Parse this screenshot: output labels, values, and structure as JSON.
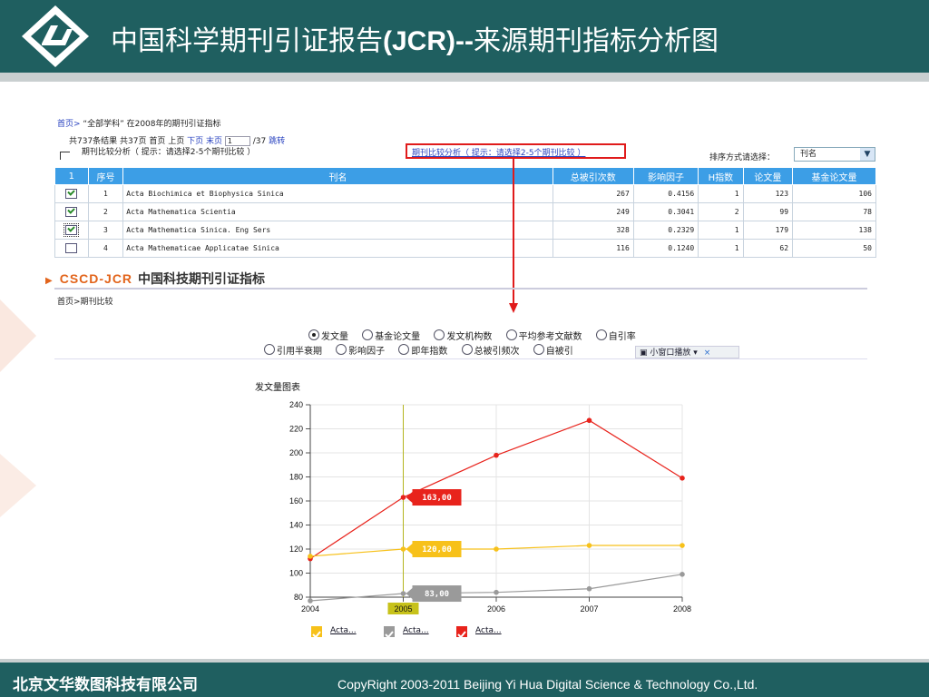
{
  "header": {
    "title_prefix": "中国科学期刊引证报告",
    "title_bold": "(JCR)--",
    "title_suffix": "来源期刊指标分析图"
  },
  "search_area": {
    "breadcrumb_home": "首页>",
    "breadcrumb_text": "“全部学科” 在2008年的期刊引证指标",
    "pager_summary": "共737条结果  共37页  首页  上页",
    "pager_next": "下页",
    "pager_last": "末页",
    "pager_page_value": "1",
    "pager_total": "/37",
    "pager_jump": "跳转",
    "compare_label": "期刊比较分析（ 提示：请选择2-5个期刊比较 ）",
    "compare_link": "期刊比较分析（ 提示：请选择2-5个期刊比较 ）",
    "sort_label": "排序方式请选择：",
    "sort_value": "刊名"
  },
  "table": {
    "headers": [
      "1",
      "序号",
      "刊名",
      "总被引次数",
      "影响因子",
      "H指数",
      "论文量",
      "基金论文量"
    ],
    "rows": [
      {
        "checked": true,
        "idx": "1",
        "name": "Acta Biochimica et Biophysica Sinica",
        "cites": "267",
        "if": "0.4156",
        "h": "1",
        "papers": "123",
        "fund": "106"
      },
      {
        "checked": true,
        "idx": "2",
        "name": "Acta Mathematica Scientia",
        "cites": "249",
        "if": "0.3041",
        "h": "2",
        "papers": "99",
        "fund": "78"
      },
      {
        "checked": true,
        "idx": "3",
        "name": "Acta Mathematica Sinica. Eng Sers",
        "cites": "328",
        "if": "0.2329",
        "h": "1",
        "papers": "179",
        "fund": "138"
      },
      {
        "checked": false,
        "idx": "4",
        "name": "Acta Mathematicae Applicatae Sinica",
        "cites": "116",
        "if": "0.1240",
        "h": "1",
        "papers": "62",
        "fund": "50"
      }
    ]
  },
  "compare": {
    "brand": "CSCD-JCR",
    "brand_title": "中国科技期刊引证指标",
    "breadcrumb": "首页>期刊比较",
    "row1": [
      "发文量",
      "基金论文量",
      "发文机构数",
      "平均参考文献数",
      "自引率"
    ],
    "row2": [
      "引用半衰期",
      "影响因子",
      "即年指数",
      "总被引频次",
      "自被引"
    ],
    "selected": "发文量",
    "popup_label": "小窗口播放",
    "popup_close": "×"
  },
  "chart_title": "发文量图表",
  "chart_data": {
    "type": "line",
    "x": [
      "2004",
      "2005",
      "2006",
      "2007",
      "2008"
    ],
    "ylim": [
      80,
      240
    ],
    "yticks": [
      80,
      100,
      120,
      140,
      160,
      180,
      200,
      220,
      240
    ],
    "grid": true,
    "highlight_x": "2005",
    "series": [
      {
        "name": "Acta...",
        "color": "#e8231c",
        "values": [
          112,
          163,
          198,
          227,
          179
        ],
        "callout": "163,00"
      },
      {
        "name": "Acta...",
        "color": "#f7c11a",
        "values": [
          114,
          120,
          120,
          123,
          123
        ],
        "callout": "120,00"
      },
      {
        "name": "Acta...",
        "color": "#9a9a9a",
        "values": [
          77,
          83,
          84,
          87,
          99
        ],
        "callout": "83,00"
      }
    ],
    "legend_order": [
      1,
      2,
      0
    ],
    "legend_placement": "bottom"
  },
  "footer": {
    "company_cn": "北京文华数图科技有限公司",
    "copyright": "CopyRight 2003-2011 Beijing Yi Hua Digital Science & Technology Co.,Ltd."
  },
  "colors": {
    "brand_teal": "#1f5f60",
    "table_header": "#3c9ee6",
    "highlight_red": "#e01b1b",
    "accent_orange": "#e2641b"
  }
}
